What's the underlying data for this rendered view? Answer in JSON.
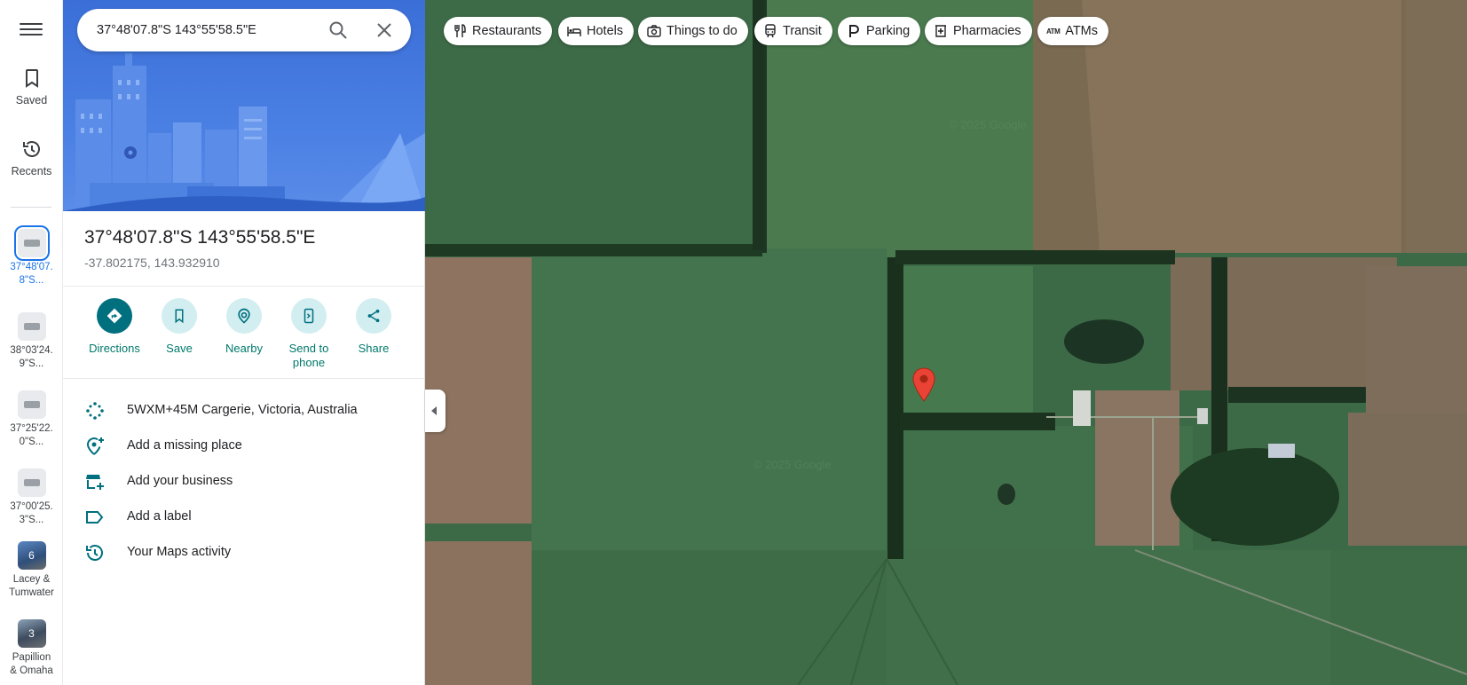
{
  "search": {
    "value": "37°48'07.8\"S 143°55'58.5\"E"
  },
  "rail": {
    "saved_label": "Saved",
    "recents_label": "Recents",
    "recent_items": [
      {
        "label_line1": "37°48'07.",
        "label_line2": "8\"S..."
      },
      {
        "label_line1": "38°03'24.",
        "label_line2": "9\"S..."
      },
      {
        "label_line1": "37°25'22.",
        "label_line2": "0\"S..."
      },
      {
        "label_line1": "37°00'25.",
        "label_line2": "3\"S..."
      },
      {
        "label_line1": "Lacey &",
        "label_line2": "Tumwater",
        "count": "6"
      },
      {
        "label_line1": "Papillion",
        "label_line2": "& Omaha",
        "count": "3"
      }
    ]
  },
  "place": {
    "title": "37°48'07.8\"S 143°55'58.5\"E",
    "coords": "-37.802175, 143.932910"
  },
  "actions": [
    {
      "line1": "Directions",
      "line2": "",
      "icon": "directions-icon"
    },
    {
      "line1": "Save",
      "line2": "",
      "icon": "bookmark-icon"
    },
    {
      "line1": "Nearby",
      "line2": "",
      "icon": "nearby-icon"
    },
    {
      "line1": "Send to",
      "line2": "phone",
      "icon": "phone-send-icon"
    },
    {
      "line1": "Share",
      "line2": "",
      "icon": "share-icon"
    }
  ],
  "info_rows": [
    {
      "text": "5WXM+45M Cargerie, Victoria, Australia",
      "icon": "plus-code-icon"
    },
    {
      "text": "Add a missing place",
      "icon": "add-place-icon"
    },
    {
      "text": "Add your business",
      "icon": "add-business-icon"
    },
    {
      "text": "Add a label",
      "icon": "label-icon"
    },
    {
      "text": "Your Maps activity",
      "icon": "history-icon"
    }
  ],
  "chips": [
    {
      "label": "Restaurants",
      "icon": "restaurant-icon"
    },
    {
      "label": "Hotels",
      "icon": "hotel-icon"
    },
    {
      "label": "Things to do",
      "icon": "camera-icon"
    },
    {
      "label": "Transit",
      "icon": "transit-icon"
    },
    {
      "label": "Parking",
      "icon": "parking-icon"
    },
    {
      "label": "Pharmacies",
      "icon": "pharmacy-icon"
    },
    {
      "label": "ATMs",
      "icon": "atm-icon"
    }
  ],
  "map": {
    "watermark": "© 2025 Google",
    "pin_color": "#ea4335",
    "accent_color": "#00707f"
  }
}
